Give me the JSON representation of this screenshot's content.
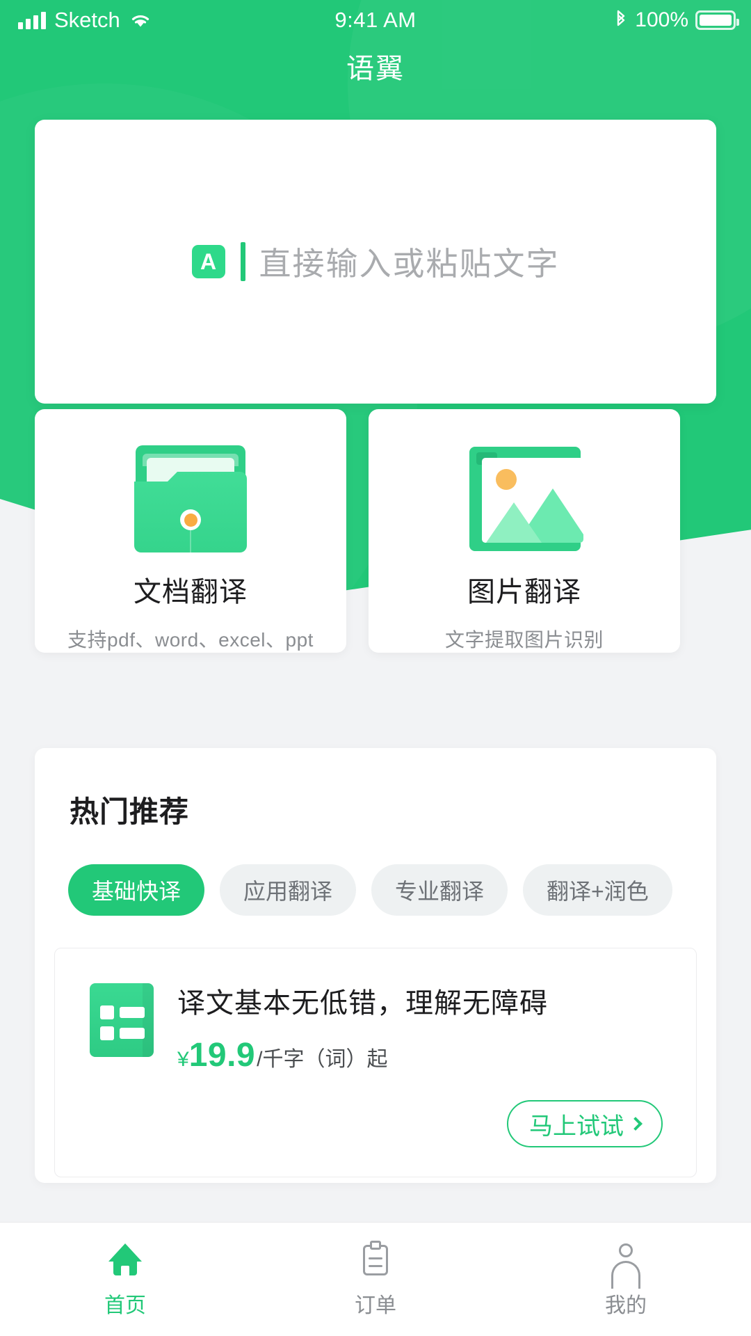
{
  "status_bar": {
    "carrier": "Sketch",
    "time": "9:41 AM",
    "battery_percent": "100%",
    "wifi_icon": "wifi-icon",
    "bluetooth_icon": "bluetooth-icon",
    "signal_icon": "signal-bars-icon"
  },
  "header": {
    "title": "语翼"
  },
  "input_card": {
    "badge_letter": "A",
    "placeholder": "直接输入或粘贴文字"
  },
  "features": [
    {
      "icon": "folder-icon",
      "title": "文档翻译",
      "subtitle": "支持pdf、word、excel、ppt"
    },
    {
      "icon": "picture-icon",
      "title": "图片翻译",
      "subtitle": "文字提取图片识别"
    }
  ],
  "recommend": {
    "title": "热门推荐",
    "tabs": [
      {
        "label": "基础快译",
        "active": true
      },
      {
        "label": "应用翻译",
        "active": false
      },
      {
        "label": "专业翻译",
        "active": false
      },
      {
        "label": "翻译+润色",
        "active": false
      }
    ],
    "product": {
      "icon": "document-list-icon",
      "title": "译文基本无低错，理解无障碍",
      "currency": "¥",
      "amount": "19.9",
      "unit": "/千字（词）起",
      "cta_label": "马上试试",
      "cta_icon": "chevron-right-icon"
    }
  },
  "tabbar": [
    {
      "label": "首页",
      "icon": "home-icon",
      "active": true
    },
    {
      "label": "订单",
      "icon": "clipboard-icon",
      "active": false
    },
    {
      "label": "我的",
      "icon": "person-icon",
      "active": false
    }
  ],
  "colors": {
    "brand_green": "#22c878",
    "accent_orange": "#f9ab42",
    "page_bg": "#f2f3f5",
    "muted_text": "#8a8d91"
  }
}
